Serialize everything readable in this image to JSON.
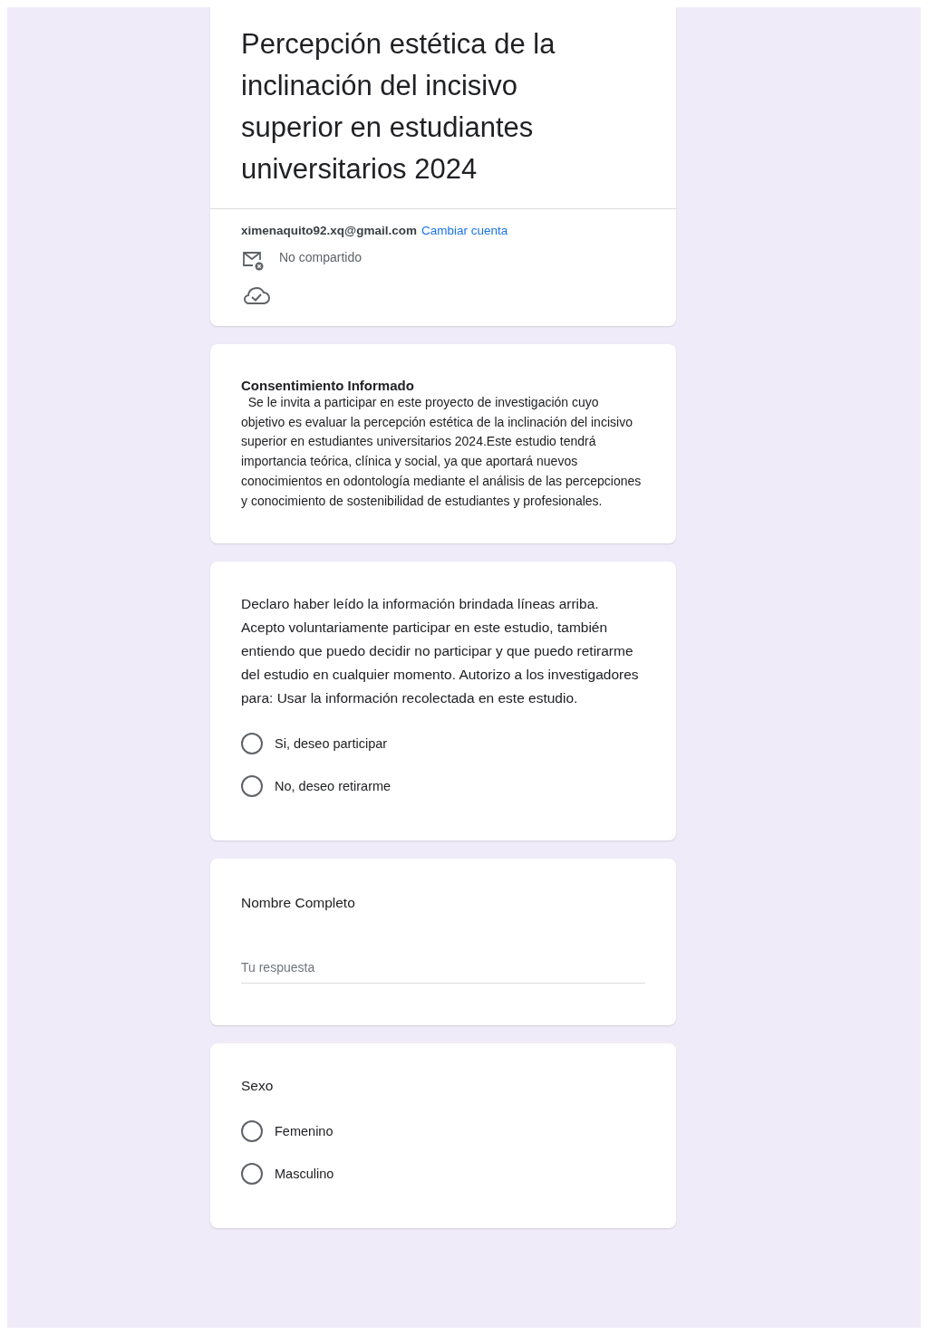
{
  "form": {
    "title": "Percepción estética de la inclinación del incisivo superior en estudiantes universitarios 2024",
    "account": {
      "email": "ximenaquito92.xq@gmail.com",
      "switch_link": "Cambiar cuenta",
      "sharing": "No compartido"
    }
  },
  "sections": [
    {
      "kind": "info",
      "heading": "Consentimiento Informado",
      "body": "  Se le invita a participar en este proyecto de investigación cuyo objetivo es evaluar la percepción estética de la inclinación del incisivo superior en estudiantes universitarios 2024.Este estudio tendrá importancia teórica, clínica y social, ya que aportará nuevos conocimientos en odontología mediante el análisis de las percepciones y conocimiento de sostenibilidad de estudiantes y profesionales."
    },
    {
      "kind": "radio",
      "question": "Declaro haber leído la información brindada líneas arriba. Acepto voluntariamente participar en este estudio, también entiendo que puedo decidir no participar y que puedo retirarme del estudio en cualquier momento. Autorizo a los investigadores para:  Usar la información recolectada en este estudio.",
      "options": [
        {
          "label": "Si, deseo participar",
          "selected": false
        },
        {
          "label": "No, deseo retirarme",
          "selected": false
        }
      ]
    },
    {
      "kind": "text",
      "question": "Nombre Completo",
      "placeholder": "Tu respuesta"
    },
    {
      "kind": "radio",
      "question": "Sexo",
      "options": [
        {
          "label": "Femenino",
          "selected": false
        },
        {
          "label": "Masculino",
          "selected": false
        }
      ]
    }
  ]
}
